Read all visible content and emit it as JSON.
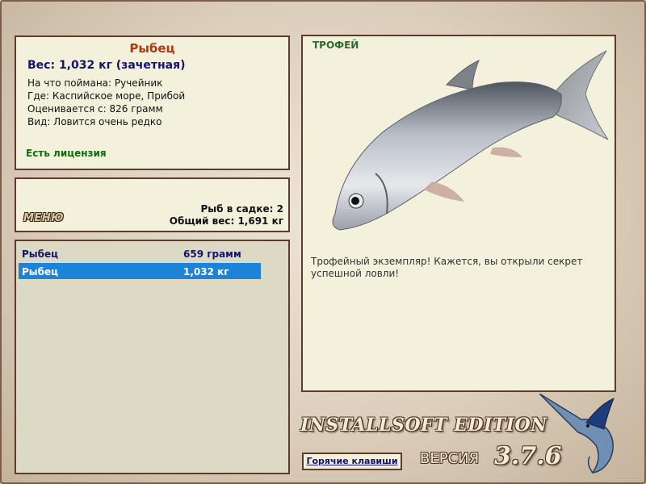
{
  "info": {
    "title": "Рыбец",
    "weight": "Вес: 1,032 кг (зачетная)",
    "caught_on": "На что поймана: Ручейник",
    "where": "Где: Каспийское море, Прибой",
    "valued_from": "Оценивается с: 826 грамм",
    "rarity": "Вид: Ловится очень редко",
    "license": "Есть лицензия"
  },
  "stats": {
    "menu_label": "МЕНЮ",
    "fish_in_keepnet": "Рыб в садке: 2",
    "total_weight": "Общий вес: 1,691 кг"
  },
  "catch_list": [
    {
      "name": "Рыбец",
      "weight": "659 грамм",
      "selected": false
    },
    {
      "name": "Рыбец",
      "weight": "1,032 кг",
      "selected": true
    }
  ],
  "trophy": {
    "label": "ТРОФЕЙ",
    "description": "Трофейный экземпляр! Кажется, вы открыли секрет успешной ловли!"
  },
  "branding": {
    "edition": "INSTALLSOFT EDITION",
    "version_label": "ВЕРСИЯ",
    "version": "3.7.6",
    "hotkeys_button": "Горячие клавиши"
  },
  "icons": {
    "fish_image": "roach-fish-image",
    "logo": "marlin-logo-icon"
  },
  "colors": {
    "panel_bg": "#f3f0dc",
    "panel_border": "#5e3c2a",
    "title": "#b03a10",
    "weight": "#14146e",
    "license": "#116b11",
    "selection": "#1c84d8"
  }
}
